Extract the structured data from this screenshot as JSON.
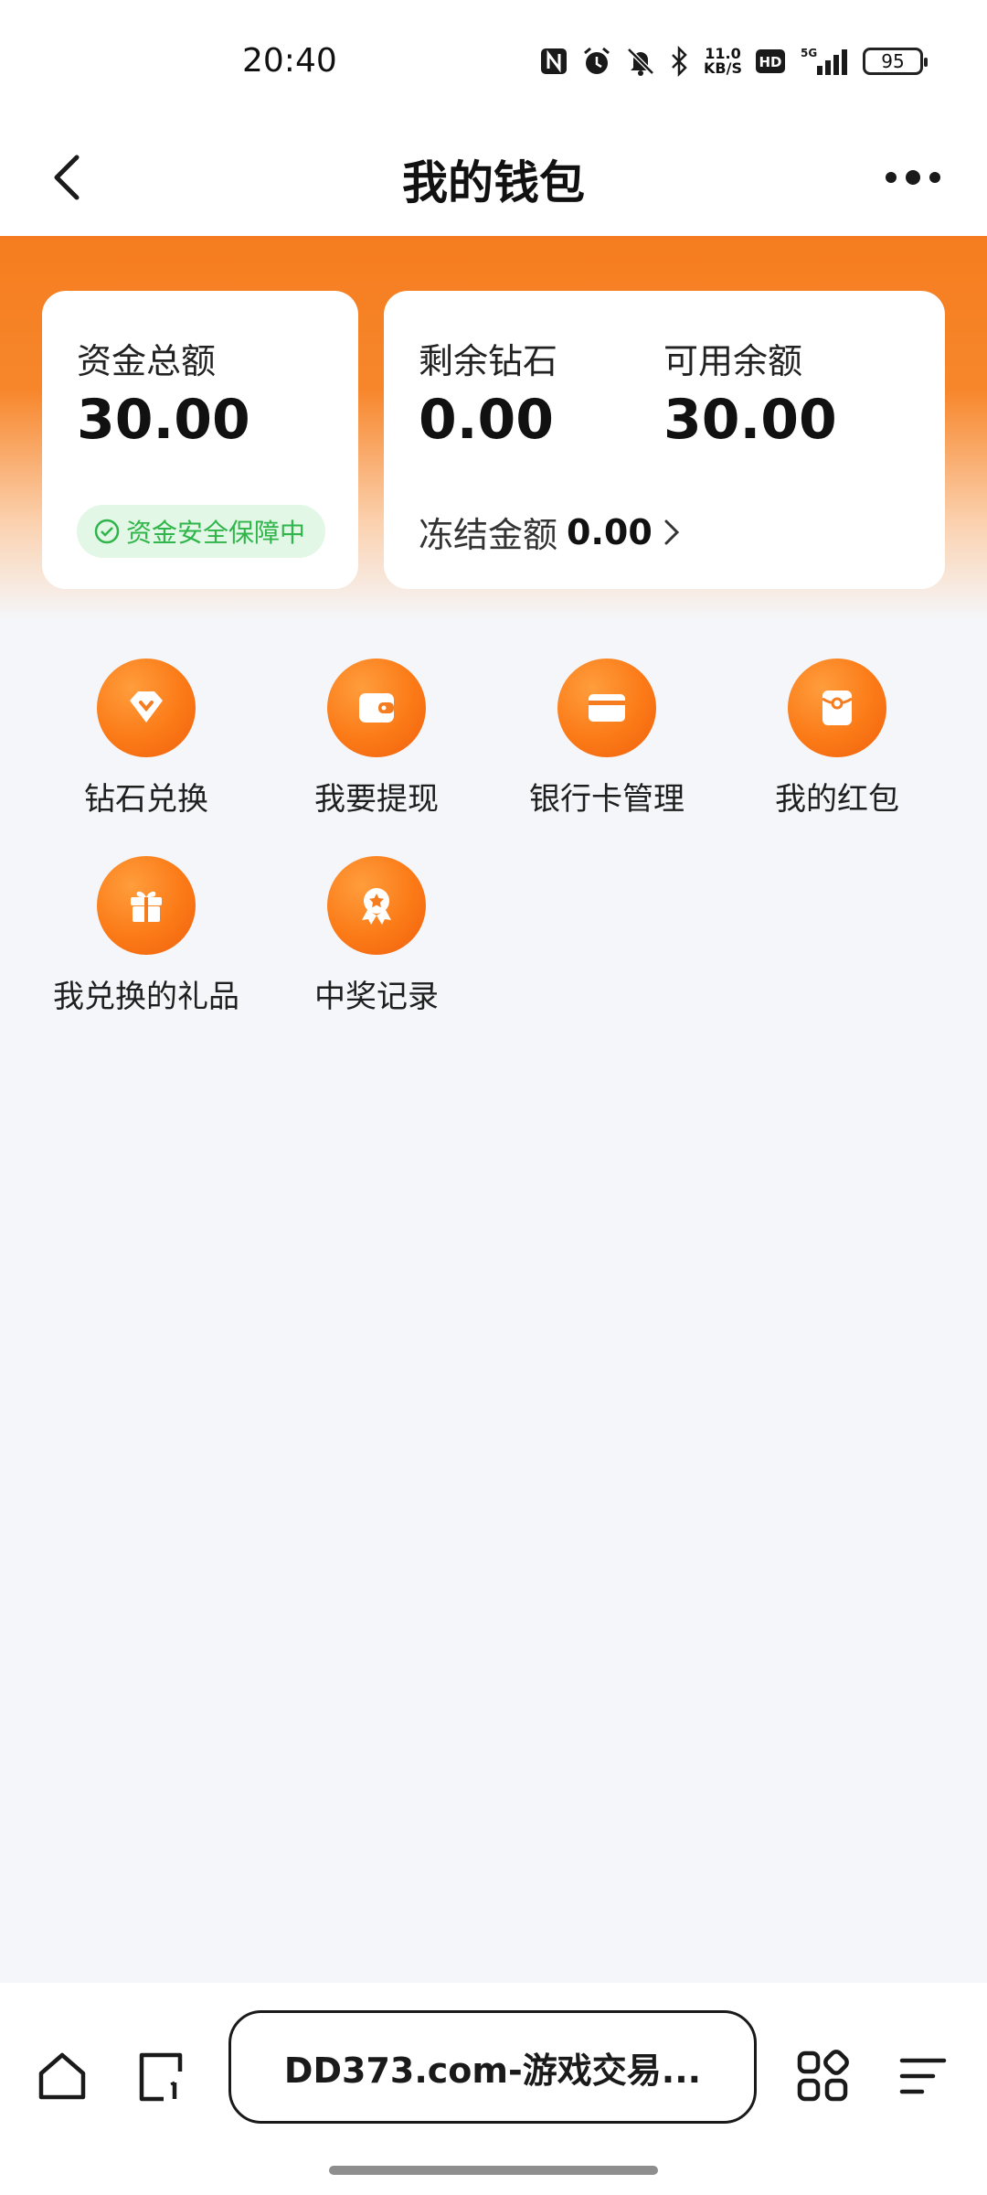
{
  "status": {
    "time": "20:40",
    "net_speed_top": "11.0",
    "net_speed_bottom": "KB/S",
    "hd": "HD",
    "net": "5G",
    "battery": "95"
  },
  "header": {
    "title": "我的钱包"
  },
  "cards": {
    "total": {
      "label": "资金总额",
      "value": "30.00",
      "badge": "资金安全保障中"
    },
    "balance": {
      "diamond_label": "剩余钻石",
      "diamond_value": "0.00",
      "available_label": "可用余额",
      "available_value": "30.00",
      "frozen_label": "冻结金额",
      "frozen_value": "0.00"
    }
  },
  "grid": [
    {
      "label": "钻石兑换",
      "icon": "diamond-icon"
    },
    {
      "label": "我要提现",
      "icon": "wallet-icon"
    },
    {
      "label": "银行卡管理",
      "icon": "bank-card-icon"
    },
    {
      "label": "我的红包",
      "icon": "red-packet-icon"
    },
    {
      "label": "我兑换的礼品",
      "icon": "gift-icon"
    },
    {
      "label": "中奖记录",
      "icon": "award-icon"
    }
  ],
  "browser": {
    "url_text": "DD373.com-游戏交易..."
  },
  "colors": {
    "accent": "#f57d1f",
    "safe_green": "#2fb54a",
    "safe_bg": "#e2f7e5",
    "page_bg": "#f5f6fa"
  }
}
